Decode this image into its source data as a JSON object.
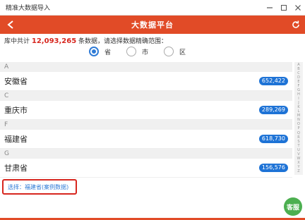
{
  "window": {
    "title": "精准大数据导入"
  },
  "header": {
    "title": "大数据平台"
  },
  "info": {
    "prefix": "库中共计",
    "count": "12,093,265",
    "suffix": "条数据，请选择数据精确范围："
  },
  "scope": {
    "options": [
      {
        "label": "省",
        "checked": true
      },
      {
        "label": "市",
        "checked": false
      },
      {
        "label": "区",
        "checked": false
      }
    ]
  },
  "list": [
    {
      "letter": "A",
      "name": "安徽省",
      "count": "652,422"
    },
    {
      "letter": "C",
      "name": "重庆市",
      "count": "289,269"
    },
    {
      "letter": "F",
      "name": "福建省",
      "count": "618,730"
    },
    {
      "letter": "G",
      "name": "甘肃省",
      "count": "156,576"
    }
  ],
  "alphabet": [
    "A",
    "B",
    "C",
    "D",
    "E",
    "F",
    "G",
    "H",
    "I",
    "J",
    "K",
    "L",
    "M",
    "N",
    "O",
    "P",
    "Q",
    "R",
    "S",
    "T",
    "U",
    "V",
    "W",
    "X",
    "Y",
    "Z"
  ],
  "selection": {
    "text": "选择：福建省(案例数据)"
  },
  "service": {
    "label": "客服"
  },
  "colors": {
    "brand": "#e14b27",
    "badge": "#1e73d6",
    "accent": "#2f7bd6",
    "highlight": "#d7261e",
    "service": "#4caf50"
  }
}
